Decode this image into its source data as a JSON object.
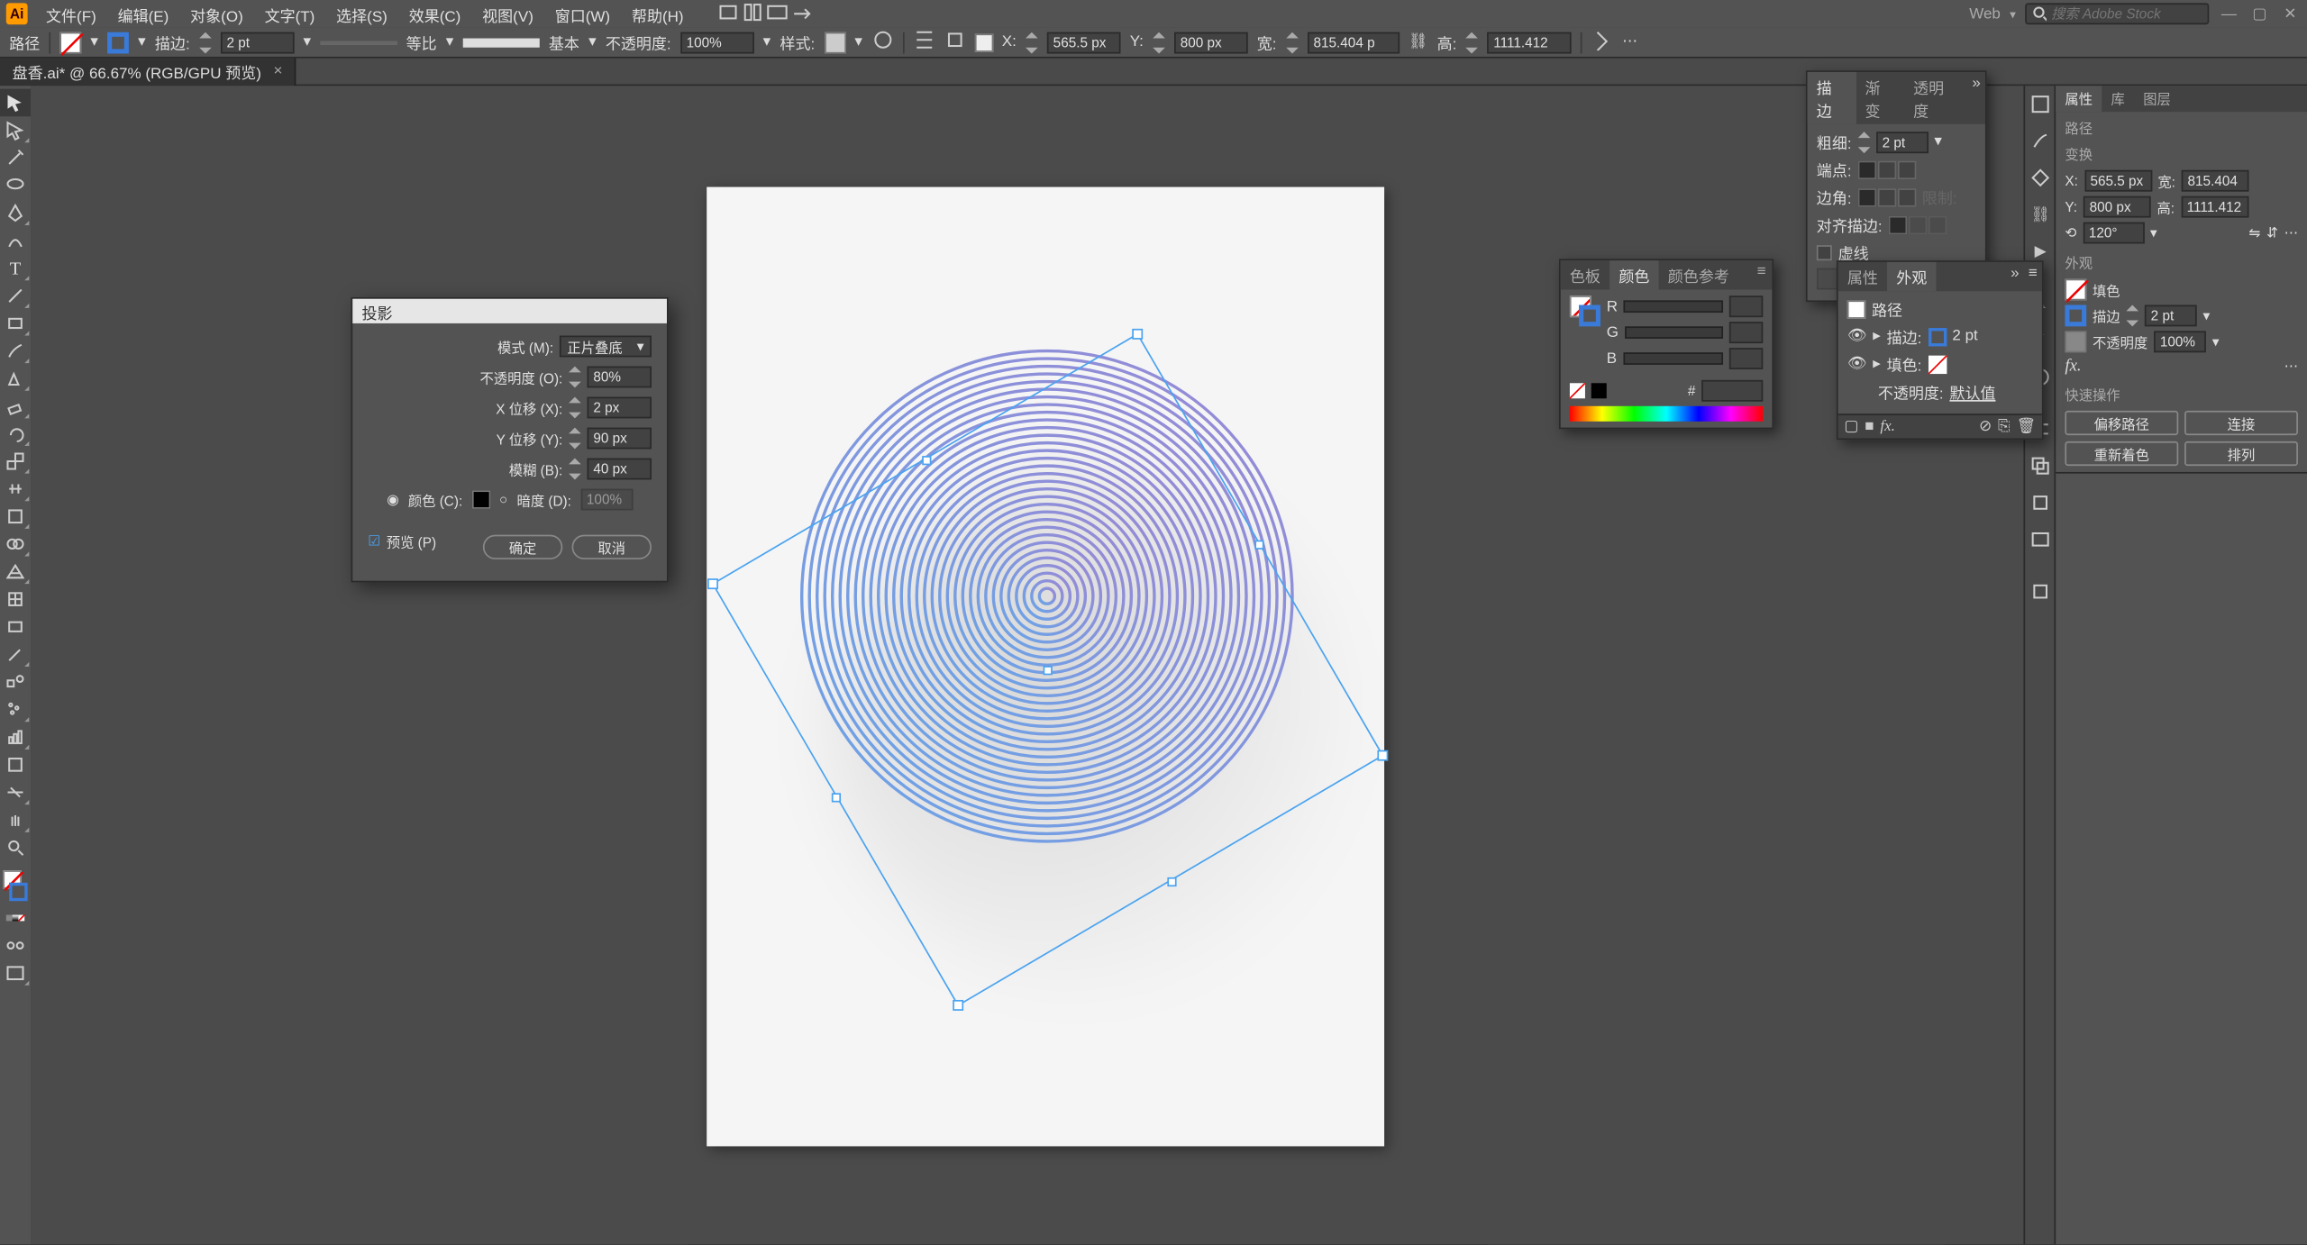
{
  "app": {
    "logo": "Ai"
  },
  "menu": {
    "items": [
      "文件(F)",
      "编辑(E)",
      "对象(O)",
      "文字(T)",
      "选择(S)",
      "效果(C)",
      "视图(V)",
      "窗口(W)",
      "帮助(H)"
    ]
  },
  "topbar": {
    "workspace_label": "Web",
    "search_placeholder": "搜索 Adobe Stock"
  },
  "options": {
    "selection_label": "路径",
    "stroke_label": "描边:",
    "stroke_weight": "2 pt",
    "uniform": "等比",
    "basic": "基本",
    "opacity_label": "不透明度:",
    "opacity": "100%",
    "style_label": "样式:",
    "x_label": "X:",
    "x": "565.5 px",
    "y_label": "Y:",
    "y": "800 px",
    "w_label": "宽:",
    "w": "815.404 px",
    "h_label": "高:",
    "h": "1111.412"
  },
  "doc_tab": {
    "title": "盘香.ai* @ 66.67% (RGB/GPU 预览)"
  },
  "dialog": {
    "title": "投影",
    "mode_label": "模式 (M):",
    "mode_value": "正片叠底",
    "opacity_label": "不透明度 (O):",
    "opacity": "80%",
    "xoff_label": "X 位移 (X):",
    "xoff": "2 px",
    "yoff_label": "Y 位移 (Y):",
    "yoff": "90 px",
    "blur_label": "模糊 (B):",
    "blur": "40 px",
    "color_label": "颜色 (C):",
    "dark_label": "暗度 (D):",
    "dark": "100%",
    "preview_label": "预览 (P)",
    "ok": "确定",
    "cancel": "取消"
  },
  "color_panel": {
    "t1": "色板",
    "t2": "颜色",
    "t3": "颜色参考",
    "r": "R",
    "g": "G",
    "b": "B"
  },
  "stroke_panel": {
    "t1": "描边",
    "t2": "渐变",
    "t3": "透明度",
    "weight_label": "粗细:",
    "weight": "2 pt",
    "cap_label": "端点:",
    "corner_label": "边角:",
    "limit_label": " ",
    "align_label": "对齐描边:",
    "dashed_label": "虚线"
  },
  "appearance_panel": {
    "t1": "属性",
    "t2": "外观",
    "path": "路径",
    "stroke": "描边:",
    "stroke_val": "2 pt",
    "fill": "填色:",
    "opacity": "不透明度:",
    "opacity_val": "默认值"
  },
  "props_panel": {
    "t1": "属性",
    "t2": "库",
    "t3": "图层",
    "sec1": "路径",
    "sec_transform": "变换",
    "x_lbl": "X:",
    "x": "565.5 px",
    "w_lbl": "宽:",
    "w": "815.404",
    "y_lbl": "Y:",
    "y": "800 px",
    "h_lbl": "高:",
    "h": "1111.412",
    "angle": "120°",
    "sec_appearance": "外观",
    "fill": "填色",
    "stroke": "描边",
    "stroke_val": "2 pt",
    "opacity": "不透明度",
    "opacity_val": "100%",
    "sec_quick": "快速操作",
    "btn1": "偏移路径",
    "btn2": "连接",
    "btn3": "重新着色",
    "btn4": "排列"
  }
}
